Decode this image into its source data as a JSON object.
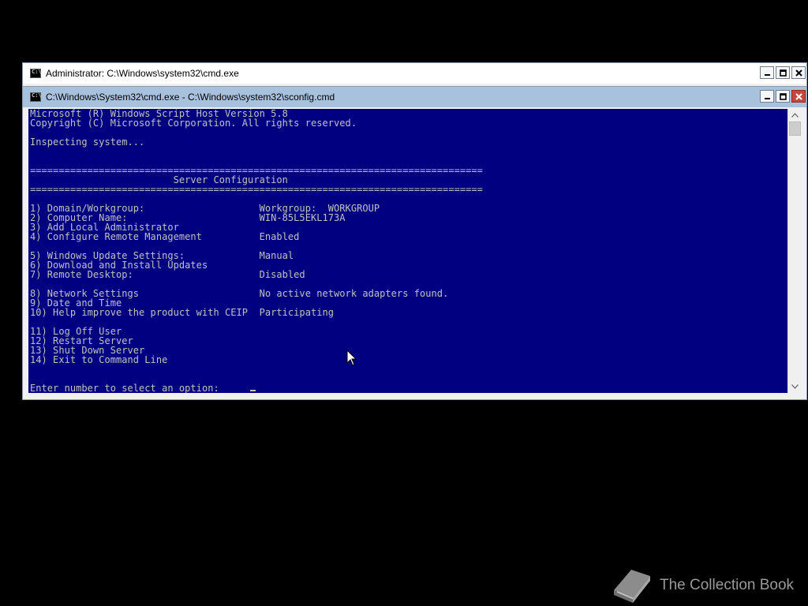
{
  "windows": {
    "back": {
      "title": "Administrator: C:\\Windows\\system32\\cmd.exe"
    },
    "front": {
      "title": "C:\\Windows\\System32\\cmd.exe - C:\\Windows\\system32\\sconfig.cmd"
    }
  },
  "console": {
    "lines": [
      "Microsoft (R) Windows Script Host Version 5.8",
      "Copyright (C) Microsoft Corporation. All rights reserved.",
      "",
      "Inspecting system...",
      "",
      "",
      "===============================================================================",
      "                         Server Configuration",
      "===============================================================================",
      "",
      "1) Domain/Workgroup:                    Workgroup:  WORKGROUP",
      "2) Computer Name:                       WIN-85L5EKL173A",
      "3) Add Local Administrator",
      "4) Configure Remote Management          Enabled",
      "",
      "5) Windows Update Settings:             Manual",
      "6) Download and Install Updates",
      "7) Remote Desktop:                      Disabled",
      "",
      "8) Network Settings                     No active network adapters found.",
      "9) Date and Time",
      "10) Help improve the product with CEIP  Participating",
      "",
      "11) Log Off User",
      "12) Restart Server",
      "13) Shut Down Server",
      "14) Exit to Command Line",
      "",
      "",
      "Enter number to select an option: "
    ]
  },
  "watermark": {
    "text": "The Collection Book"
  },
  "colors": {
    "console_bg": "#000080",
    "console_fg": "#c0c0c0",
    "desktop": "#000000"
  }
}
